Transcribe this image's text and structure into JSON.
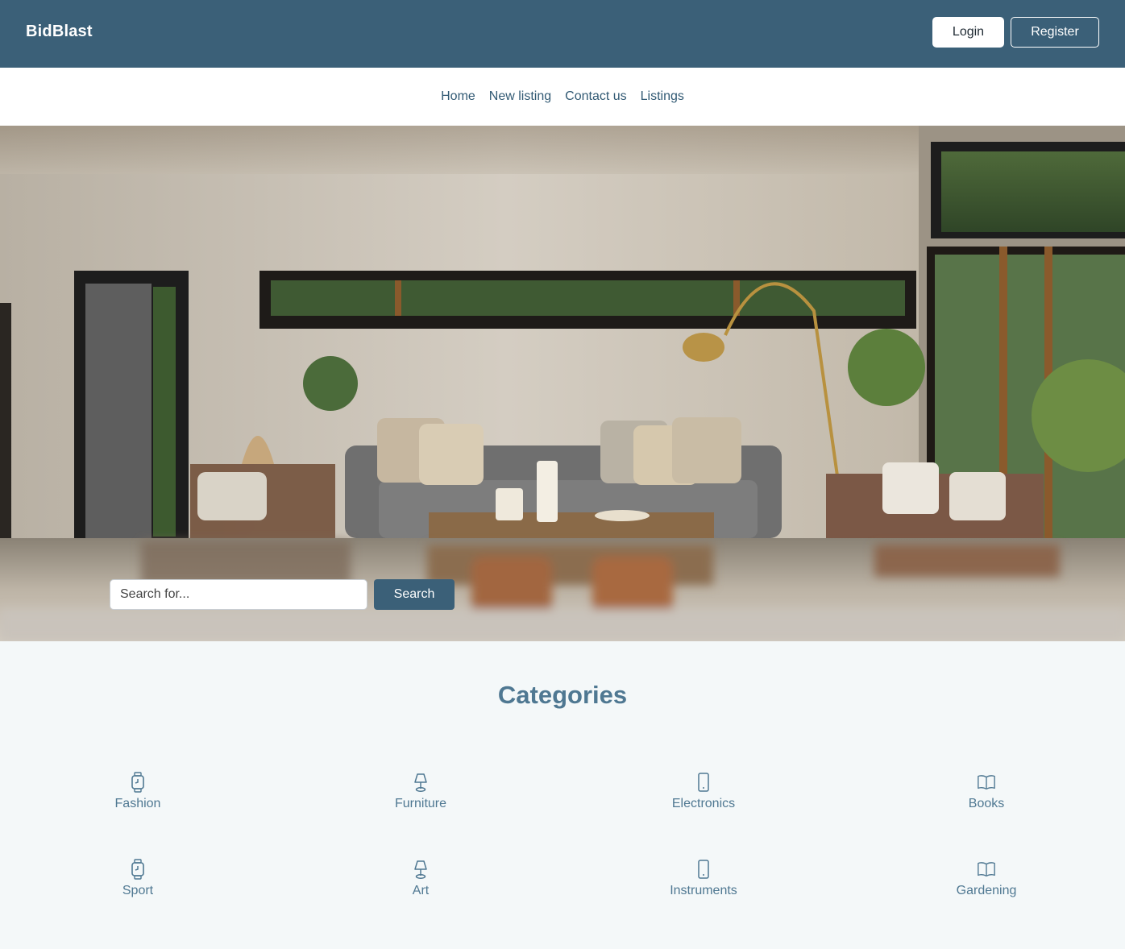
{
  "header": {
    "brand": "BidBlast",
    "login_label": "Login",
    "register_label": "Register"
  },
  "nav": {
    "items": [
      "Home",
      "New listing",
      "Contact us",
      "Listings"
    ]
  },
  "search": {
    "placeholder": "Search for...",
    "button_label": "Search"
  },
  "categories": {
    "title": "Categories",
    "items": [
      {
        "label": "Fashion",
        "icon": "watch-icon"
      },
      {
        "label": "Furniture",
        "icon": "lamp-icon"
      },
      {
        "label": "Electronics",
        "icon": "phone-icon"
      },
      {
        "label": "Books",
        "icon": "book-icon"
      },
      {
        "label": "Sport",
        "icon": "watch-icon"
      },
      {
        "label": "Art",
        "icon": "lamp-icon"
      },
      {
        "label": "Instruments",
        "icon": "phone-icon"
      },
      {
        "label": "Gardening",
        "icon": "book-icon"
      }
    ]
  },
  "colors": {
    "primary": "#3b6078",
    "accent_text": "#4f7892",
    "page_bg": "#f4f8f9"
  }
}
